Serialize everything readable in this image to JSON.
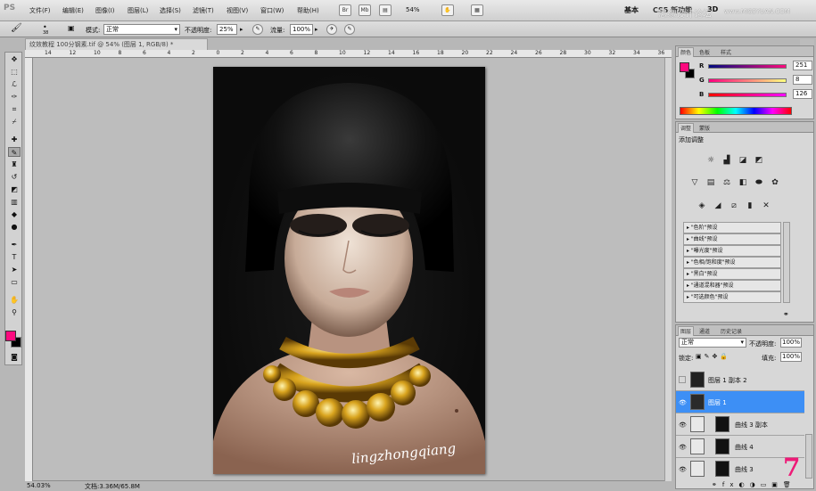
{
  "app": {
    "logo": "PS"
  },
  "menu": [
    "文件(F)",
    "编辑(E)",
    "图像(I)",
    "图层(L)",
    "选择(S)",
    "滤镜(T)",
    "视图(V)",
    "窗口(W)",
    "帮助(H)"
  ],
  "menubar": {
    "zoom": "54%",
    "workspaces": [
      "基本",
      "CS5 新功能",
      "3D"
    ],
    "watermark": "思缘设计论坛",
    "watermark_url": "www.MISSYUAN.COM"
  },
  "options": {
    "mode_label": "模式:",
    "mode_value": "正常",
    "opacity_label": "不透明度:",
    "opacity_value": "25%",
    "flow_label": "流量:",
    "flow_value": "100%",
    "brush_size": "38"
  },
  "document": {
    "tab_title": "纹效教程 100分钢素.tif @ 54% (图层 1, RGB/8) *",
    "ruler_numbers": [
      "14",
      "12",
      "10",
      "8",
      "6",
      "4",
      "2",
      "0",
      "2",
      "4",
      "6",
      "8",
      "10",
      "12",
      "14",
      "16",
      "18",
      "20",
      "22",
      "24",
      "26",
      "28",
      "30",
      "32",
      "34",
      "36"
    ],
    "signature": "lingzhongqiang"
  },
  "status": {
    "zoom": "54.03%",
    "doc_size": "文档:3.36M/65.8M"
  },
  "color_panel": {
    "tabs": [
      "颜色",
      "色板",
      "样式"
    ],
    "r_label": "R",
    "r_value": "251",
    "g_label": "G",
    "g_value": "8",
    "b_label": "B",
    "b_value": "126",
    "foreground": "#fc0a7e"
  },
  "adjust_panel": {
    "tabs": [
      "调整",
      "蒙版"
    ],
    "title": "添加调整",
    "presets": [
      "\"色阶\"预设",
      "\"曲线\"预设",
      "\"曝光度\"预设",
      "\"色相/饱和度\"预设",
      "\"黑白\"预设",
      "\"通道混和器\"预设",
      "\"可选颜色\"预设"
    ]
  },
  "layers_panel": {
    "tabs": [
      "图层",
      "通道",
      "历史记录"
    ],
    "blend_mode": "正常",
    "opacity_label": "不透明度:",
    "opacity_value": "100%",
    "lock_label": "锁定:",
    "fill_label": "填充:",
    "fill_value": "100%",
    "layers": [
      {
        "name": "图层 1 副本 2",
        "visible": false
      },
      {
        "name": "图层 1",
        "visible": true,
        "selected": true
      },
      {
        "name": "曲线 3 副本",
        "visible": true
      },
      {
        "name": "曲线 4",
        "visible": true
      },
      {
        "name": "曲线 3",
        "visible": true
      }
    ]
  },
  "corner_logo": "7"
}
